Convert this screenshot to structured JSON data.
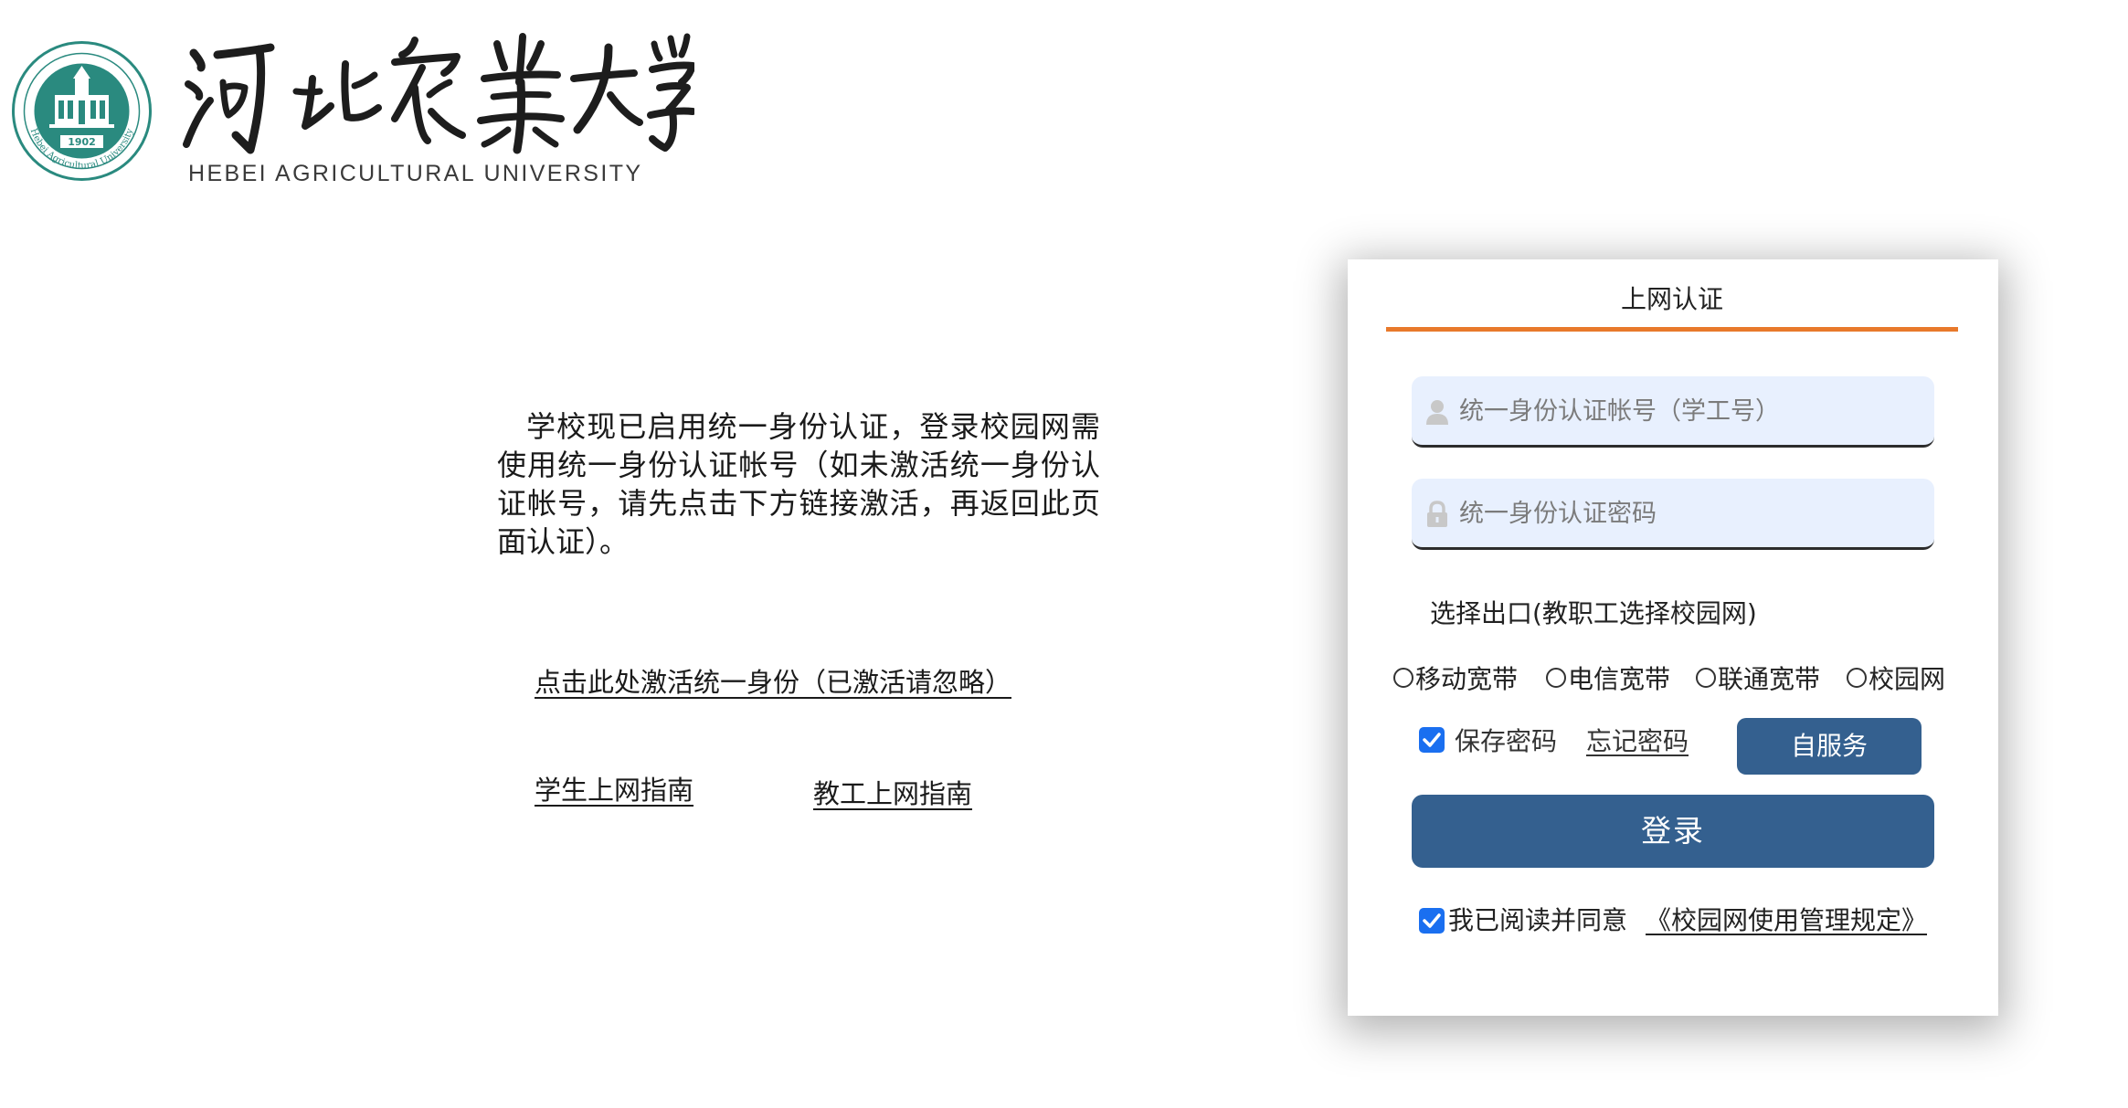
{
  "logo": {
    "calligraphy": "河北农业大学",
    "english_name": "HEBEI AGRICULTURAL UNIVERSITY",
    "seal_year": "1902",
    "seal_ring_text": "Hebei Agricultural University",
    "brand_color": "#2a8a7f"
  },
  "notice": {
    "text": "学校现已启用统一身份认证，登录校园网需使用统一身份认证帐号（如未激活统一身份认证帐号，请先点击下方链接激活，再返回此页面认证）。",
    "activate_link": "点击此处激活统一身份（已激活请忽略）",
    "student_guide_link": "学生上网指南",
    "staff_guide_link": "教工上网指南"
  },
  "login": {
    "title": "上网认证",
    "accent_color": "#e8792b",
    "username": {
      "placeholder": "统一身份认证帐号（学工号）",
      "value": "",
      "icon": "user-icon"
    },
    "password": {
      "placeholder": "统一身份认证密码",
      "value": "",
      "icon": "lock-icon"
    },
    "exit_label": "选择出口(教职工选择校园网)",
    "exit_options": [
      {
        "label": "移动宽带",
        "selected": false
      },
      {
        "label": "电信宽带",
        "selected": false
      },
      {
        "label": "联通宽带",
        "selected": false
      },
      {
        "label": "校园网",
        "selected": false
      }
    ],
    "save_password": {
      "label": "保存密码",
      "checked": true
    },
    "forgot_password_link": "忘记密码",
    "self_service_button": "自服务",
    "login_button": "登录",
    "button_color": "#34608f",
    "agree": {
      "label": "我已阅读并同意",
      "checked": true
    },
    "policy_link": "《校园网使用管理规定》"
  }
}
